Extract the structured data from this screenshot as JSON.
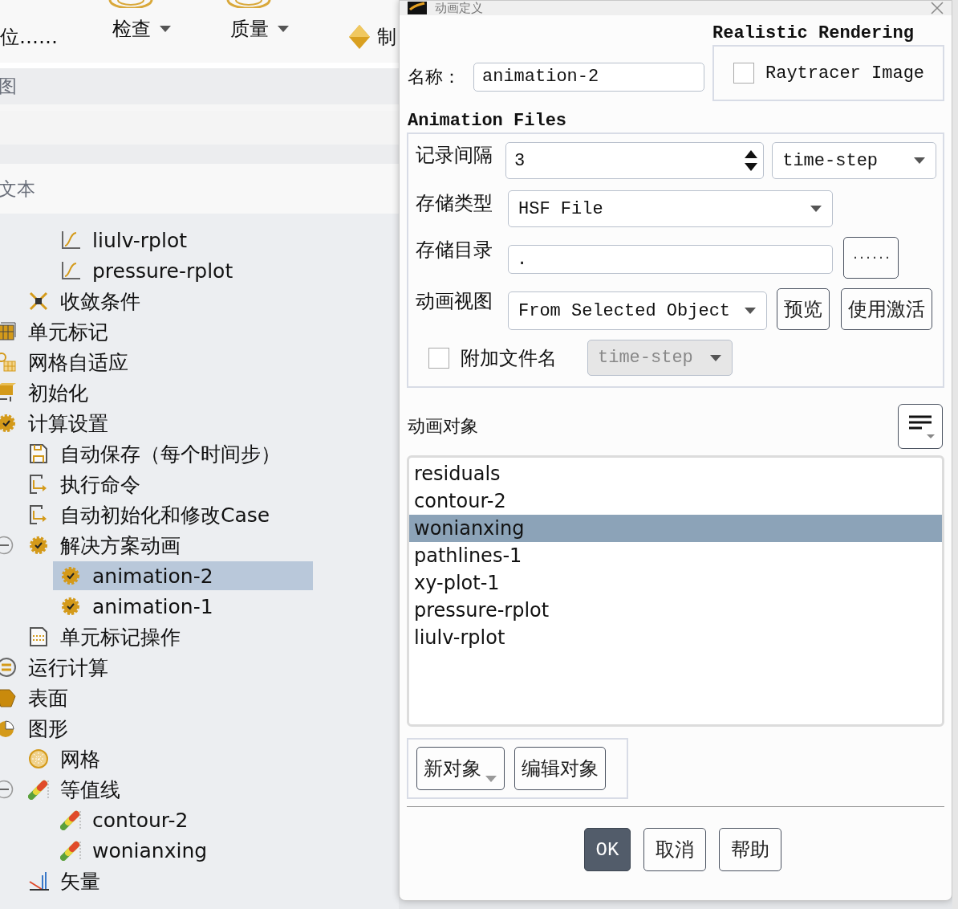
{
  "toolbar": {
    "items": [
      {
        "kind": "plain",
        "label": "位……",
        "dropdown": false
      },
      {
        "kind": "ring",
        "label": "检查",
        "dropdown": true
      },
      {
        "kind": "ring",
        "label": "质量",
        "dropdown": true
      },
      {
        "kind": "diamond",
        "label": "制",
        "dropdown": false
      }
    ]
  },
  "section_headers": [
    {
      "label": "图"
    },
    {
      "label": "文本"
    }
  ],
  "tree": [
    {
      "children": [
        {
          "children": [
            {
              "kind": "plot",
              "label": "liulv-rplot",
              "selected": false
            },
            {
              "kind": "plot",
              "label": "pressure-rplot",
              "selected": false
            }
          ]
        },
        {
          "kind": "convergence",
          "label": "收敛条件",
          "selected": false
        }
      ]
    },
    {
      "kind": "cells",
      "label": "单元标记",
      "selected": false
    },
    {
      "kind": "adapt",
      "label": "网格自适应",
      "selected": false
    },
    {
      "kind": "init",
      "label": "初始化",
      "selected": false
    },
    {
      "kind": "gear",
      "label": "计算设置",
      "selected": false,
      "children": [
        {
          "kind": "save",
          "label": "自动保存（每个时间步）",
          "selected": false
        },
        {
          "kind": "command",
          "label": "执行命令",
          "selected": false
        },
        {
          "kind": "command",
          "label": "自动初始化和修改Case",
          "selected": false
        },
        {
          "kind": "gear",
          "label": "解决方案动画",
          "selected": false,
          "expanded": true,
          "children": [
            {
              "kind": "gear",
              "label": "animation-2",
              "selected": true
            },
            {
              "kind": "gear",
              "label": "animation-1",
              "selected": false
            }
          ]
        },
        {
          "kind": "doc",
          "label": "单元标记操作",
          "selected": false
        }
      ]
    },
    {
      "kind": "run",
      "label": "运行计算",
      "selected": false
    },
    {
      "kind": "surface",
      "label": "表面",
      "selected": false
    },
    {
      "kind": "graphics",
      "label": "图形",
      "selected": false,
      "children": [
        {
          "kind": "mesh",
          "label": "网格",
          "selected": false
        },
        {
          "kind": "contour",
          "label": "等值线",
          "selected": false,
          "expanded": true,
          "children": [
            {
              "kind": "contour",
              "label": "contour-2",
              "selected": false
            },
            {
              "kind": "contour",
              "label": "wonianxing",
              "selected": false
            }
          ]
        },
        {
          "kind": "vector",
          "label": "矢量",
          "selected": false
        }
      ]
    }
  ],
  "dialog": {
    "title": "动画定义",
    "name_label": "名称：",
    "name_value": "animation-2",
    "rendering": {
      "title": "Realistic Rendering",
      "label": "Raytracer Image",
      "checked": false
    },
    "files": {
      "title": "Animation Files",
      "rows": [
        {
          "kind": "spin",
          "label": "记录间隔",
          "value": "3",
          "unit": "time-step"
        },
        {
          "kind": "select",
          "label": "存储类型",
          "value": "HSF File"
        },
        {
          "kind": "path",
          "label": "存储目录",
          "value": ".",
          "browse": "······"
        },
        {
          "kind": "view",
          "label": "动画视图",
          "value": "From Selected Object",
          "buttons": [
            "预览",
            "使用激活"
          ]
        }
      ],
      "append": {
        "label": "附加文件名",
        "checked": false,
        "value": "time-step",
        "disabled": true
      }
    },
    "objects": {
      "label": "动画对象",
      "items": [
        {
          "label": "residuals",
          "selected": false
        },
        {
          "label": "contour-2",
          "selected": false
        },
        {
          "label": "wonianxing",
          "selected": true
        },
        {
          "label": "pathlines-1",
          "selected": false
        },
        {
          "label": "xy-plot-1",
          "selected": false
        },
        {
          "label": "pressure-rplot",
          "selected": false
        },
        {
          "label": "liulv-rplot",
          "selected": false
        }
      ]
    },
    "object_buttons": [
      {
        "label": "新对象",
        "dropdown": true
      },
      {
        "label": "编辑对象",
        "dropdown": false
      }
    ],
    "buttons": [
      {
        "label": "OK",
        "primary": true
      },
      {
        "label": "取消",
        "primary": false
      },
      {
        "label": "帮助",
        "primary": false
      }
    ]
  }
}
